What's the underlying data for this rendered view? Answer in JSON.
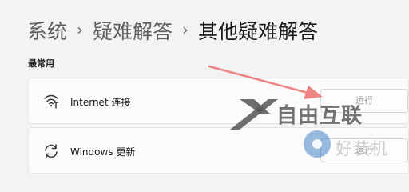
{
  "breadcrumb": {
    "items": [
      "系统",
      "疑难解答"
    ],
    "separator": "›",
    "current": "其他疑难解答"
  },
  "section": {
    "title": "最常用"
  },
  "troubleshooters": [
    {
      "label": "Internet 连接",
      "icon": "wifi-icon",
      "button_label": "运行"
    },
    {
      "label": "Windows 更新",
      "icon": "refresh-icon",
      "button_label": "运行"
    }
  ],
  "watermarks": {
    "brand": "自由互联",
    "site": "好装机"
  },
  "colors": {
    "background": "#f3f3f3",
    "card": "#fbfbfb",
    "annotation_arrow": "#ee8585"
  }
}
